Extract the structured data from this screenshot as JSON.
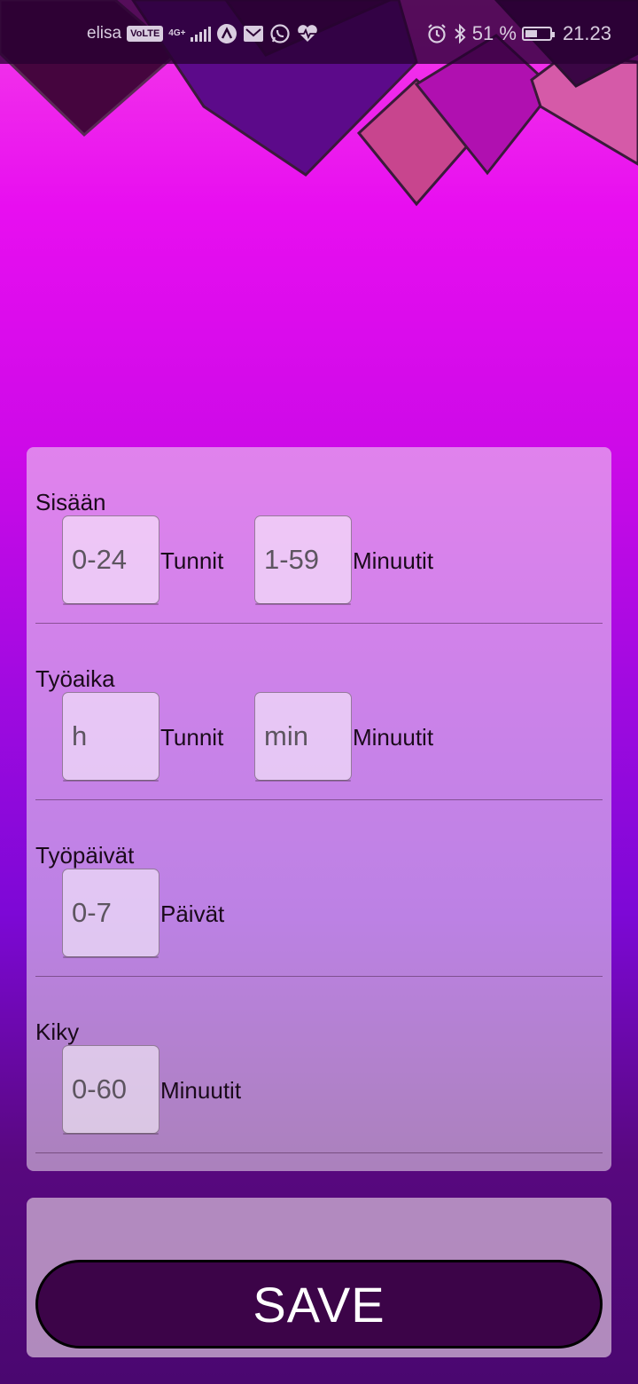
{
  "status_bar": {
    "carrier": "elisa",
    "volte_badge": "VoLTE",
    "network_type": "4G+",
    "battery_text": "51 %",
    "battery_level": 0.51,
    "time": "21.23",
    "icons": [
      "app-a-icon",
      "mail-icon",
      "whatsapp-icon",
      "heart-rate-icon",
      "alarm-icon",
      "bluetooth-icon",
      "battery-icon"
    ]
  },
  "form": {
    "sections": [
      {
        "label": "Sisään",
        "fields": [
          {
            "placeholder": "0-24",
            "unit": "Tunnit"
          },
          {
            "placeholder": "1-59",
            "unit": "Minuutit"
          }
        ]
      },
      {
        "label": "Työaika",
        "fields": [
          {
            "placeholder": "h",
            "unit": "Tunnit"
          },
          {
            "placeholder": "min",
            "unit": "Minuutit"
          }
        ]
      },
      {
        "label": "Työpäivät",
        "fields": [
          {
            "placeholder": "0-7",
            "unit": "Päivät"
          }
        ]
      },
      {
        "label": "Kiky",
        "fields": [
          {
            "placeholder": "0-60",
            "unit": "Minuutit"
          }
        ]
      }
    ]
  },
  "save": {
    "label": "SAVE"
  },
  "colors": {
    "background_top": "#f53ce8",
    "background_bottom": "#4a0770",
    "save_button": "#3c0448"
  }
}
